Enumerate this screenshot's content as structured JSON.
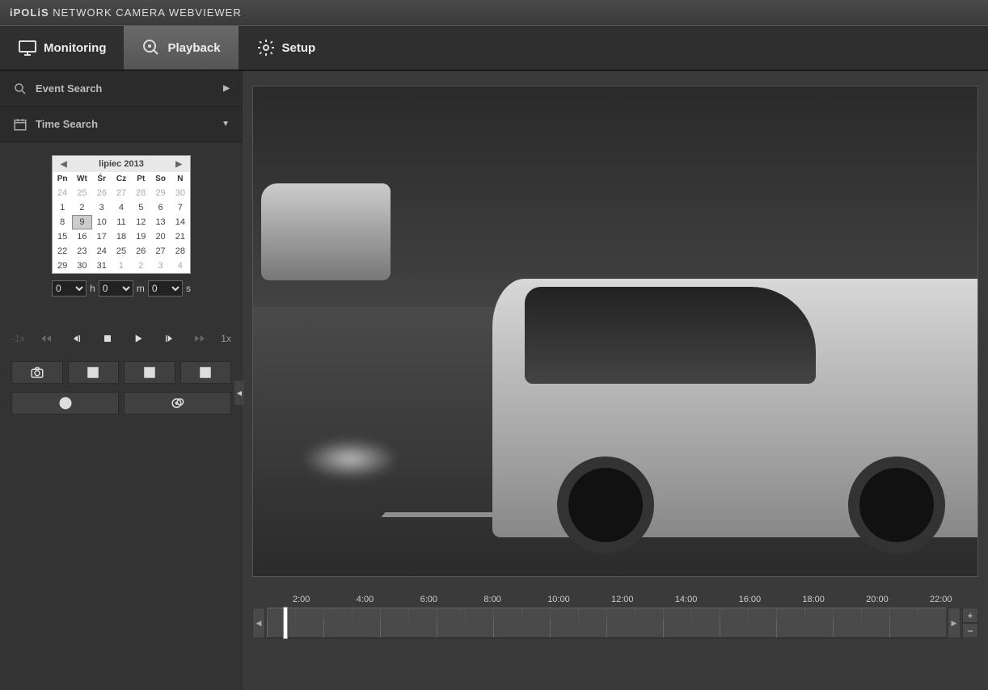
{
  "header": {
    "brand_prefix": "iPOLiS",
    "brand_rest": "NETWORK CAMERA WEBVIEWER"
  },
  "tabs": {
    "monitoring": "Monitoring",
    "playback": "Playback",
    "setup": "Setup"
  },
  "sidebar": {
    "event_search": "Event Search",
    "time_search": "Time Search"
  },
  "calendar": {
    "title": "lipiec 2013",
    "day_headers": [
      "Pn",
      "Wt",
      "Śr",
      "Cz",
      "Pt",
      "So",
      "N"
    ],
    "weeks": [
      [
        {
          "n": "24",
          "o": true
        },
        {
          "n": "25",
          "o": true
        },
        {
          "n": "26",
          "o": true
        },
        {
          "n": "27",
          "o": true
        },
        {
          "n": "28",
          "o": true
        },
        {
          "n": "29",
          "o": true
        },
        {
          "n": "30",
          "o": true
        }
      ],
      [
        {
          "n": "1"
        },
        {
          "n": "2"
        },
        {
          "n": "3"
        },
        {
          "n": "4"
        },
        {
          "n": "5"
        },
        {
          "n": "6"
        },
        {
          "n": "7"
        }
      ],
      [
        {
          "n": "8"
        },
        {
          "n": "9",
          "sel": true
        },
        {
          "n": "10"
        },
        {
          "n": "11"
        },
        {
          "n": "12"
        },
        {
          "n": "13"
        },
        {
          "n": "14"
        }
      ],
      [
        {
          "n": "15"
        },
        {
          "n": "16"
        },
        {
          "n": "17"
        },
        {
          "n": "18"
        },
        {
          "n": "19"
        },
        {
          "n": "20"
        },
        {
          "n": "21"
        }
      ],
      [
        {
          "n": "22"
        },
        {
          "n": "23"
        },
        {
          "n": "24"
        },
        {
          "n": "25"
        },
        {
          "n": "26"
        },
        {
          "n": "27"
        },
        {
          "n": "28"
        }
      ],
      [
        {
          "n": "29"
        },
        {
          "n": "30"
        },
        {
          "n": "31"
        },
        {
          "n": "1",
          "o": true
        },
        {
          "n": "2",
          "o": true
        },
        {
          "n": "3",
          "o": true
        },
        {
          "n": "4",
          "o": true
        }
      ]
    ]
  },
  "time": {
    "h": "0",
    "h_label": "h",
    "m": "0",
    "m_label": "m",
    "s": "0",
    "s_label": "s"
  },
  "speed": {
    "back": "-1x",
    "fwd": "1x"
  },
  "timeline": {
    "labels": [
      "2:00",
      "4:00",
      "6:00",
      "8:00",
      "10:00",
      "12:00",
      "14:00",
      "16:00",
      "18:00",
      "20:00",
      "22:00"
    ],
    "zoom_in": "+",
    "zoom_out": "−"
  }
}
